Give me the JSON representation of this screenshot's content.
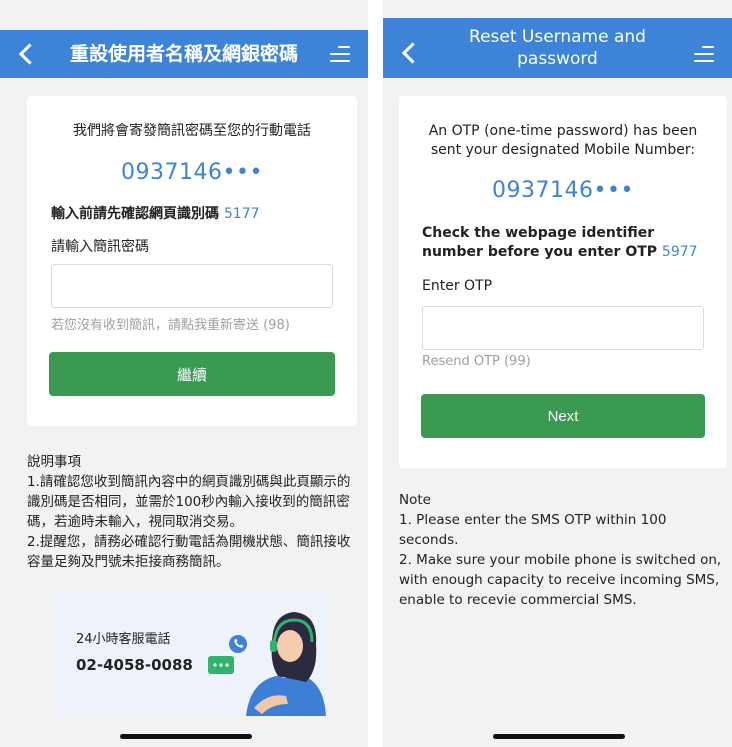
{
  "left_screen": {
    "header": {
      "title": "重設使用者名稱及網銀密碼"
    },
    "card": {
      "intro": "我們將會寄發簡訊密碼至您的行動電話",
      "phone_number": "0937146•••",
      "identifier_prefix": "輸入前請先確認網頁識別碼",
      "identifier_code": "5177",
      "otp_label": "請輸入簡訊密碼",
      "otp_value": "",
      "resend_text": "若您沒有收到簡訊，請點我重新寄送 (98)",
      "submit_label": "繼續"
    },
    "notes": {
      "heading": "說明事項",
      "items": [
        "1.請確認您收到簡訊內容中的網頁識別碼與此頁顯示的識別碼是否相同，並需於100秒內輸入接收到的簡訊密碼，若逾時未輸入，視同取消交易。",
        "2.提醒您，請務必確認行動電話為開機狀態、簡訊接收容量足夠及門號未拒接商務簡訊。"
      ]
    },
    "service": {
      "label": "24小時客服電話",
      "number": "02-4058-0088"
    }
  },
  "right_screen": {
    "header": {
      "title": "Reset Username and password"
    },
    "card": {
      "intro": "An OTP (one-time password) has been sent your designated Mobile Number:",
      "phone_number": "0937146•••",
      "identifier_prefix": "Check the webpage identifier number before you enter OTP",
      "identifier_code": "5977",
      "otp_label": "Enter OTP",
      "otp_value": "",
      "resend_text": "Resend OTP (99)",
      "submit_label": "Next"
    },
    "notes": {
      "heading": "Note",
      "items": [
        "1. Please enter the SMS OTP within 100 seconds.",
        "2. Make sure your mobile phone is switched on, with enough capacity to receive incoming SMS, enable to recevie commercial SMS."
      ]
    }
  },
  "colors": {
    "header_blue": "#3d84d9",
    "button_green": "#3a9a52",
    "background": "#f2f2f2"
  }
}
